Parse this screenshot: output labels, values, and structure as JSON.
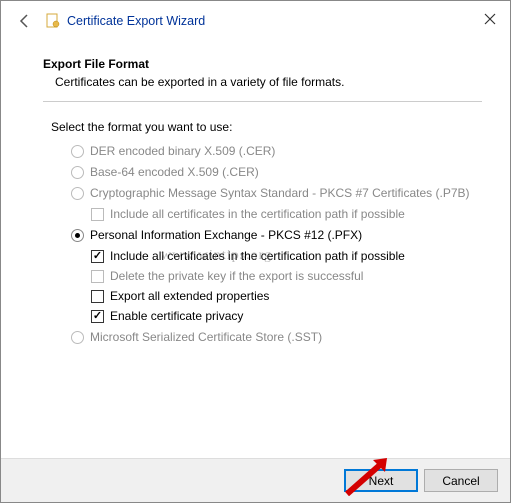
{
  "window": {
    "title": "Certificate Export Wizard"
  },
  "section": {
    "heading": "Export File Format",
    "sub": "Certificates can be exported in a variety of file formats."
  },
  "instruction": "Select the format you want to use:",
  "options": {
    "der": "DER encoded binary X.509 (.CER)",
    "base64": "Base-64 encoded X.509 (.CER)",
    "pkcs7": "Cryptographic Message Syntax Standard - PKCS #7 Certificates (.P7B)",
    "pkcs7_include": "Include all certificates in the certification path if possible",
    "pfx": "Personal Information Exchange - PKCS #12 (.PFX)",
    "pfx_include": "Include all certificates in the certification path if possible",
    "pfx_delete": "Delete the private key if the export is successful",
    "pfx_ext": "Export all extended properties",
    "pfx_privacy": "Enable certificate privacy",
    "sst": "Microsoft Serialized Certificate Store (.SST)"
  },
  "buttons": {
    "next": "Next",
    "cancel": "Cancel"
  },
  "watermark": "www.wintips.org"
}
